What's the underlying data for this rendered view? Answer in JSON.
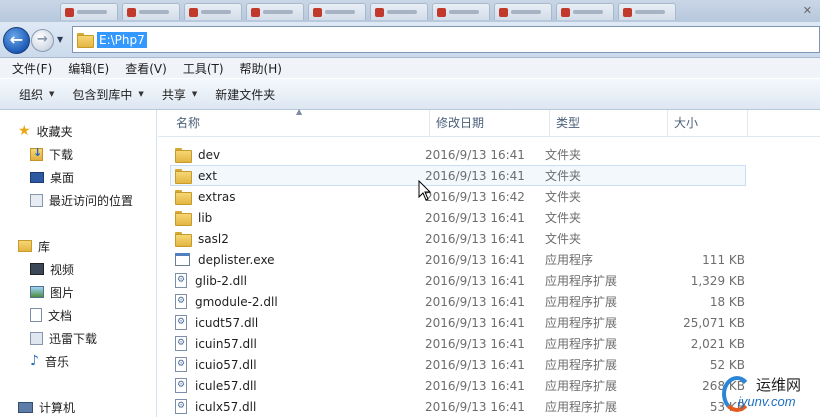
{
  "window": {
    "address_path": "E:\\Php7"
  },
  "menu": [
    "文件(F)",
    "编辑(E)",
    "查看(V)",
    "工具(T)",
    "帮助(H)"
  ],
  "commands": {
    "organize": "组织",
    "include_library": "包含到库中",
    "share": "共享",
    "new_folder": "新建文件夹"
  },
  "nav": {
    "favorites": "收藏夹",
    "downloads": "下载",
    "desktop": "桌面",
    "recent": "最近访问的位置",
    "libraries": "库",
    "videos": "视频",
    "pictures": "图片",
    "documents": "文档",
    "thunder": "迅雷下载",
    "music": "音乐",
    "computer": "计算机"
  },
  "columns": {
    "name": "名称",
    "date": "修改日期",
    "type": "类型",
    "size": "大小"
  },
  "files": [
    {
      "name": "dev",
      "date": "2016/9/13 16:41",
      "type": "文件夹",
      "size": "",
      "icon": "folder-icon"
    },
    {
      "name": "ext",
      "date": "2016/9/13 16:41",
      "type": "文件夹",
      "size": "",
      "icon": "folder-icon"
    },
    {
      "name": "extras",
      "date": "2016/9/13 16:42",
      "type": "文件夹",
      "size": "",
      "icon": "folder-icon"
    },
    {
      "name": "lib",
      "date": "2016/9/13 16:41",
      "type": "文件夹",
      "size": "",
      "icon": "folder-icon"
    },
    {
      "name": "sasl2",
      "date": "2016/9/13 16:41",
      "type": "文件夹",
      "size": "",
      "icon": "folder-icon"
    },
    {
      "name": "deplister.exe",
      "date": "2016/9/13 16:41",
      "type": "应用程序",
      "size": "111 KB",
      "icon": "exe-icon"
    },
    {
      "name": "glib-2.dll",
      "date": "2016/9/13 16:41",
      "type": "应用程序扩展",
      "size": "1,329 KB",
      "icon": "dll-icon"
    },
    {
      "name": "gmodule-2.dll",
      "date": "2016/9/13 16:41",
      "type": "应用程序扩展",
      "size": "18 KB",
      "icon": "dll-icon"
    },
    {
      "name": "icudt57.dll",
      "date": "2016/9/13 16:41",
      "type": "应用程序扩展",
      "size": "25,071 KB",
      "icon": "dll-icon"
    },
    {
      "name": "icuin57.dll",
      "date": "2016/9/13 16:41",
      "type": "应用程序扩展",
      "size": "2,021 KB",
      "icon": "dll-icon"
    },
    {
      "name": "icuio57.dll",
      "date": "2016/9/13 16:41",
      "type": "应用程序扩展",
      "size": "52 KB",
      "icon": "dll-icon"
    },
    {
      "name": "icule57.dll",
      "date": "2016/9/13 16:41",
      "type": "应用程序扩展",
      "size": "268 KB",
      "icon": "dll-icon"
    },
    {
      "name": "iculx57.dll",
      "date": "2016/9/13 16:41",
      "type": "应用程序扩展",
      "size": "53 KB",
      "icon": "dll-icon"
    }
  ],
  "hovered_row": 1,
  "watermark": {
    "cn": "运维网",
    "url": "iyunv.com"
  }
}
